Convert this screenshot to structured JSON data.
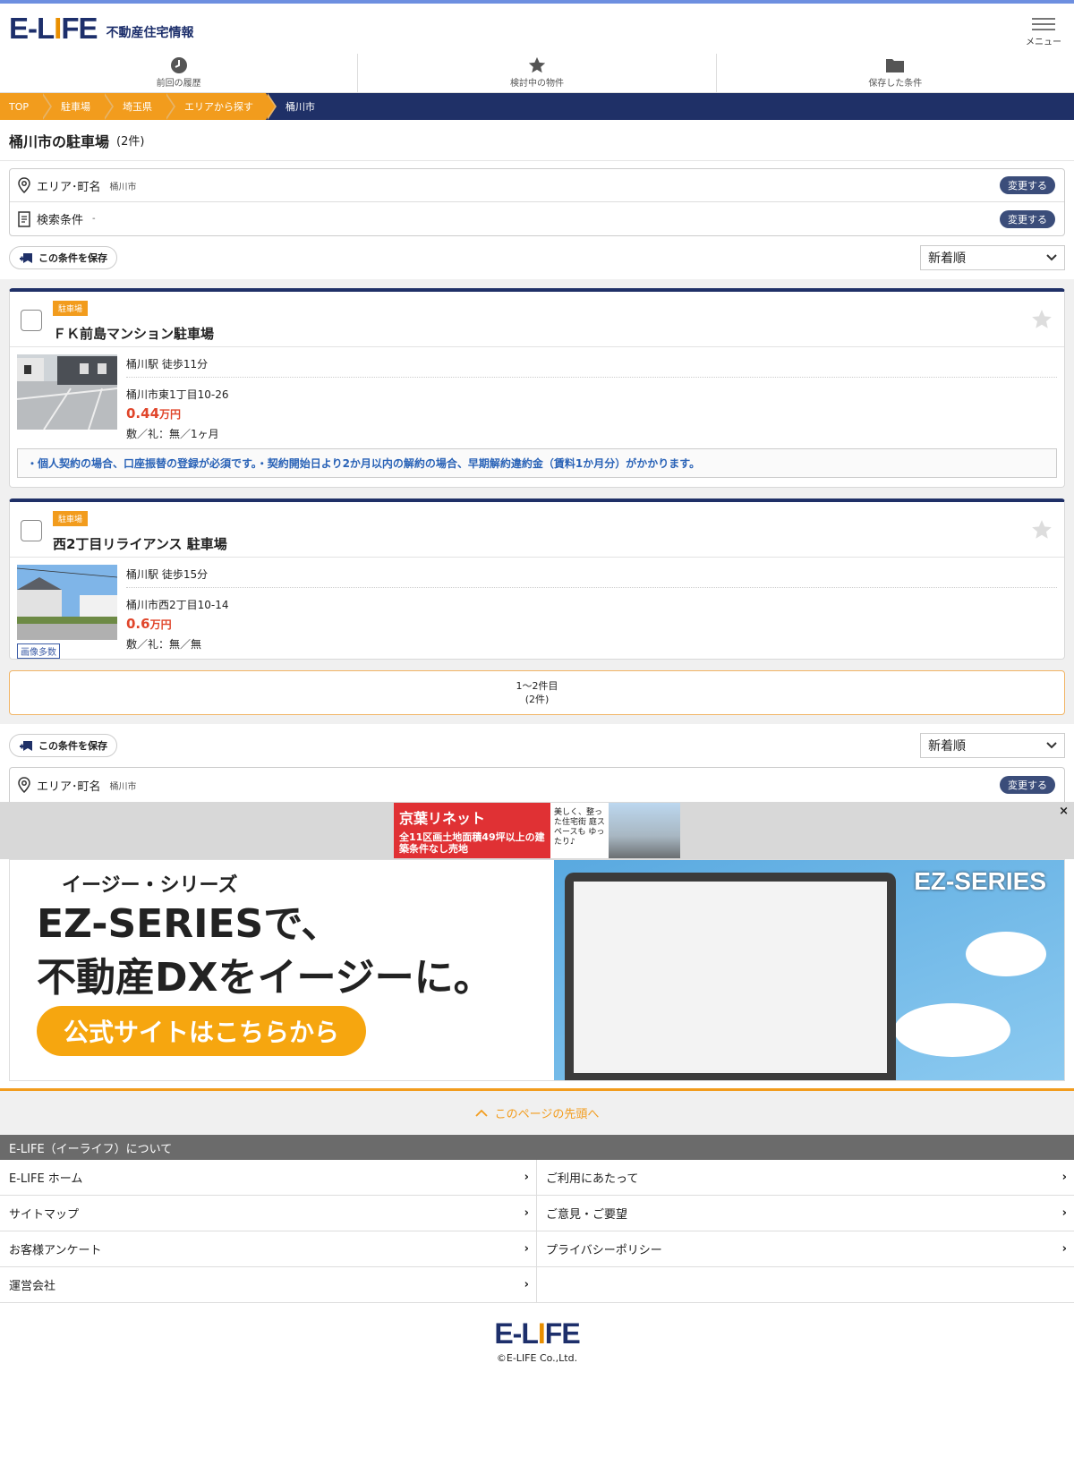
{
  "header": {
    "logo": "E-LIFE",
    "site_name": "不動産住宅情報",
    "menu_label": "メニュー"
  },
  "quicknav": [
    {
      "label": "前回の履歴",
      "icon": "clock-icon"
    },
    {
      "label": "検討中の物件",
      "icon": "star-icon"
    },
    {
      "label": "保存した条件",
      "icon": "folder-icon"
    }
  ],
  "breadcrumb": [
    "TOP",
    "駐車場",
    "埼玉県",
    "エリアから探す"
  ],
  "breadcrumb_current": "桶川市",
  "page": {
    "title": "桶川市の駐車場",
    "count": "(2件)"
  },
  "conditions": {
    "area_label": "エリア･町名",
    "area_value": "桶川市",
    "search_label": "検索条件",
    "search_value": "-",
    "change_label": "変更する"
  },
  "toolbar": {
    "save_label": "この条件を保存",
    "sort_value": "新着順"
  },
  "listings": [
    {
      "tag": "駐車場",
      "name": "ＦＫ前島マンション駐車場",
      "station": "桶川駅 徒歩11分",
      "address": "桶川市東1丁目10-26",
      "price": "0.44",
      "price_unit": "万円",
      "deposit": "敷／礼：無／1ヶ月",
      "note": "・個人契約の場合、口座振替の登録が必須です。・契約開始日より2か月以内の解約の場合、早期解約違約金（賃料1か月分）がかかります。"
    },
    {
      "tag": "駐車場",
      "name": "西2丁目リライアンス 駐車場",
      "station": "桶川駅 徒歩15分",
      "address": "桶川市西2丁目10-14",
      "price": "0.6",
      "price_unit": "万円",
      "deposit": "敷／礼：無／無",
      "badge": "画像多数"
    }
  ],
  "pager": {
    "range": "1〜2件目",
    "total": "(2件)"
  },
  "ad": {
    "title": "京葉リネット",
    "text": "全11区画土地面積49坪以上の建築条件なし売地",
    "side": "美しく、整った住宅街 庭スペースも ゆったり♪",
    "close": "×"
  },
  "ez_banner": {
    "sub": "イージー・シリーズ",
    "headline1": "EZ-SERIESで、",
    "headline2": "不動産DXをイージーに。",
    "cta": "公式サイトはこちらから",
    "logo": "EZ-SERIES"
  },
  "back_to_top": "このページの先頭へ",
  "about": {
    "heading": "E-LIFE（イーライフ）について",
    "links": [
      "E-LIFE ホーム",
      "ご利用にあたって",
      "サイトマップ",
      "ご意見・ご要望",
      "お客様アンケート",
      "プライバシーポリシー",
      "運営会社",
      ""
    ]
  },
  "footer": {
    "logo": "E-LIFE",
    "copyright": "©E-LIFE Co.,Ltd."
  },
  "colors": {
    "navy": "#1f3067",
    "orange": "#f29c1d",
    "price_red": "#e0452a"
  }
}
